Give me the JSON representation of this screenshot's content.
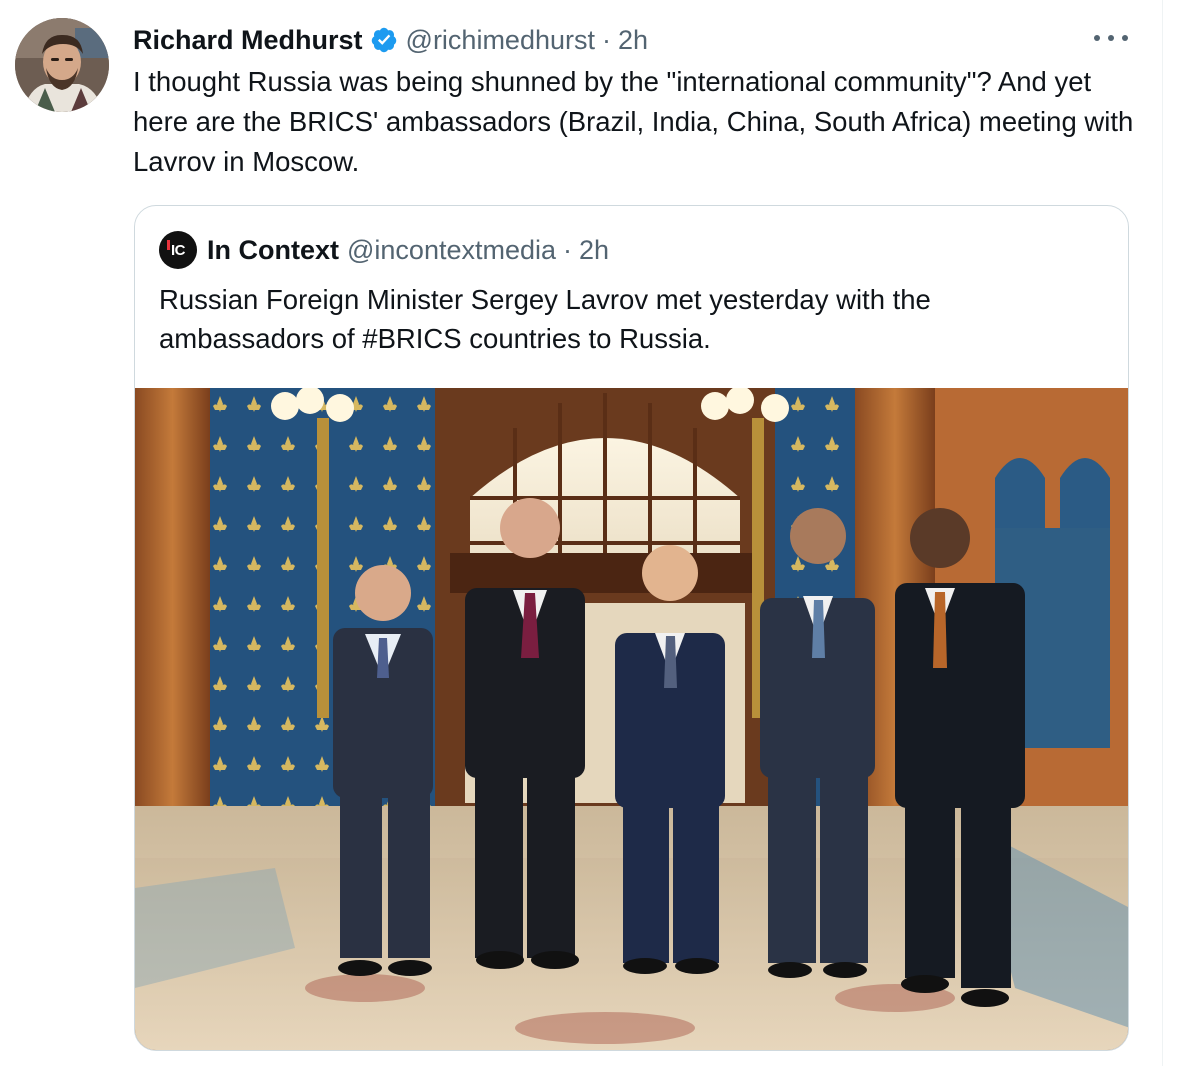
{
  "tweet": {
    "author_name": "Richard Medhurst",
    "handle": "@richimedhurst",
    "separator": "·",
    "time": "2h",
    "text": "I thought Russia was being shunned by the \"international community\"? And yet here are the BRICS' ambassadors (Brazil, India, China, South Africa) meeting with Lavrov in Moscow.",
    "verified_icon": "verified-badge-icon",
    "more_icon": "more-options-icon",
    "accent_color": "#1d9bf0"
  },
  "quote": {
    "avatar_text": "IC",
    "author_name": "In Context",
    "handle": "@incontextmedia",
    "separator": "·",
    "time": "2h",
    "text": "Russian Foreign Minister Sergey Lavrov met yesterday with the ambassadors of #BRICS countries to Russia."
  }
}
